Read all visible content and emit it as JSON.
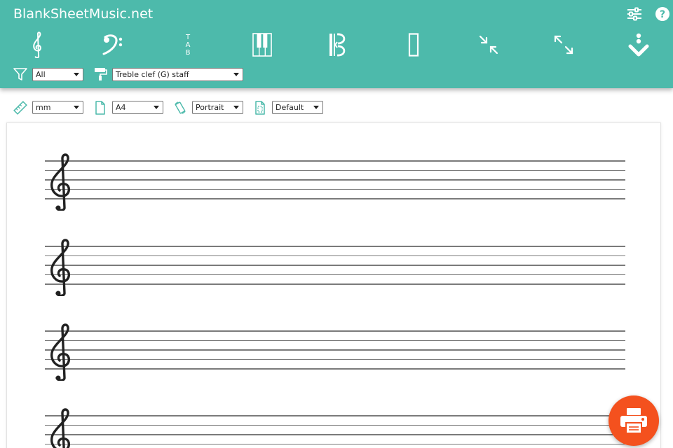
{
  "app": {
    "title": "BlankSheetMusic.net"
  },
  "header_icons": {
    "settings": "sliders-icon",
    "help": "help-icon"
  },
  "toolbar": {
    "buttons": [
      {
        "name": "treble-clef",
        "icon": "treble-clef-icon"
      },
      {
        "name": "bass-clef",
        "icon": "bass-clef-icon"
      },
      {
        "name": "tab",
        "icon": "tab-icon",
        "glyphs": [
          "T",
          "A",
          "B"
        ]
      },
      {
        "name": "piano",
        "icon": "piano-keys-icon"
      },
      {
        "name": "alto-clef",
        "icon": "alto-clef-icon"
      },
      {
        "name": "blank",
        "icon": "blank-rectangle-icon"
      },
      {
        "name": "compress",
        "icon": "compress-arrows-icon"
      },
      {
        "name": "expand",
        "icon": "expand-arrows-icon"
      },
      {
        "name": "download",
        "icon": "download-icon"
      }
    ]
  },
  "filters": {
    "filter_value": "All",
    "style_value": "Treble clef (G) staff"
  },
  "page_settings": {
    "unit_value": "mm",
    "size_value": "A4",
    "orientation_value": "Portrait",
    "margin_value": "Default"
  },
  "colors": {
    "header": "#4dbaab",
    "accent": "#4dbaab",
    "print_button": "#f4511e"
  },
  "print_button": {
    "icon": "printer-icon"
  }
}
